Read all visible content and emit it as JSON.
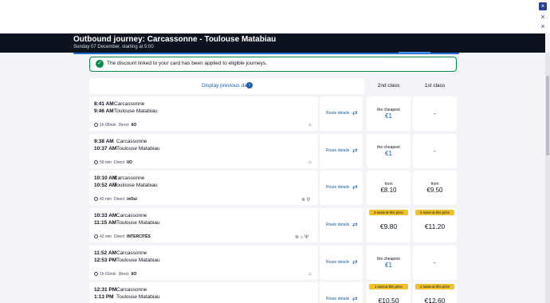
{
  "window": {
    "close_glyph": "×",
    "edge_glyph": "×"
  },
  "header": {
    "title": "Outbound journey: Carcassonne - Toulouse Matabiau",
    "subtitle": "Sunday 07 December, starting at 5:00"
  },
  "alert": {
    "check_glyph": "✓",
    "text": "The discount linked to your card has been applied to eligible journeys."
  },
  "previous": {
    "label": "Display previous day",
    "arrow_glyph": "›"
  },
  "classes": {
    "second": "2nd class",
    "first": "1st class"
  },
  "journeys": [
    {
      "dep_time": "8:41 AM",
      "dep_station": "Carcassonne",
      "arr_time": "9:46 AM",
      "arr_station": "Toulouse Matabiau",
      "duration": "1h 05min",
      "direct": "Direct",
      "operator": "liO",
      "amenities": "⌂",
      "route_label": "Route details",
      "second": {
        "kind": "cheapest",
        "label": "the cheapest",
        "value": "€1"
      },
      "first": {
        "kind": "dash",
        "value": "-"
      }
    },
    {
      "dep_time": "9:38 AM",
      "dep_station": "Carcassonne",
      "arr_time": "10:37 AM",
      "arr_station": "Toulouse Matabiau",
      "duration": "59 min",
      "direct": "Direct",
      "operator": "liO",
      "amenities": "⌂",
      "route_label": "Route details",
      "second": {
        "kind": "cheapest",
        "label": "the cheapest",
        "value": "€1"
      },
      "first": {
        "kind": "dash",
        "value": "-"
      }
    },
    {
      "dep_time": "10:10 AM",
      "dep_station": "Carcassonne",
      "arr_time": "10:52 AM",
      "arr_station": "Toulouse Matabiau",
      "duration": "42 min",
      "direct": "Direct",
      "operator": "inOui",
      "amenities": "≋  ⚲",
      "route_label": "Route details",
      "second": {
        "kind": "from",
        "label": "from",
        "value": "€8.10"
      },
      "first": {
        "kind": "from",
        "label": "from",
        "value": "€9.50"
      }
    },
    {
      "dep_time": "10:33 AM",
      "dep_station": "Carcassonne",
      "arr_time": "11:15 AM",
      "arr_station": "Toulouse Matabiau",
      "duration": "42 min",
      "direct": "Direct",
      "operator": "INTERCITÉS",
      "amenities": "≋  ⌂  Ψ",
      "route_label": "Route details",
      "second": {
        "kind": "seats",
        "label": "3 seats at this price",
        "value": "€9.80"
      },
      "first": {
        "kind": "seats",
        "label": "2 seats at this price",
        "value": "€11.20"
      }
    },
    {
      "dep_time": "11:52 AM",
      "dep_station": "Carcassonne",
      "arr_time": "12:53 PM",
      "arr_station": "Toulouse Matabiau",
      "duration": "1h 01min",
      "direct": "Direct",
      "operator": "liO",
      "amenities": "⌂",
      "route_label": "Route details",
      "second": {
        "kind": "cheapest",
        "label": "the cheapest",
        "value": "€1"
      },
      "first": {
        "kind": "dash",
        "value": "-"
      }
    },
    {
      "dep_time": "12:31 PM",
      "dep_station": "Carcassonne",
      "arr_time": "1:13 PM",
      "arr_station": "Toulouse Matabiau",
      "duration": "",
      "direct": "",
      "operator": "",
      "amenities": "",
      "route_label": "Route details",
      "second": {
        "kind": "seats",
        "label": "1 seat at this price",
        "value": "€10.50"
      },
      "first": {
        "kind": "seats",
        "label": "2 seats at this price",
        "value": "€12.60"
      }
    }
  ],
  "icons": {
    "route": "⇄",
    "clock": "clock-icon"
  }
}
